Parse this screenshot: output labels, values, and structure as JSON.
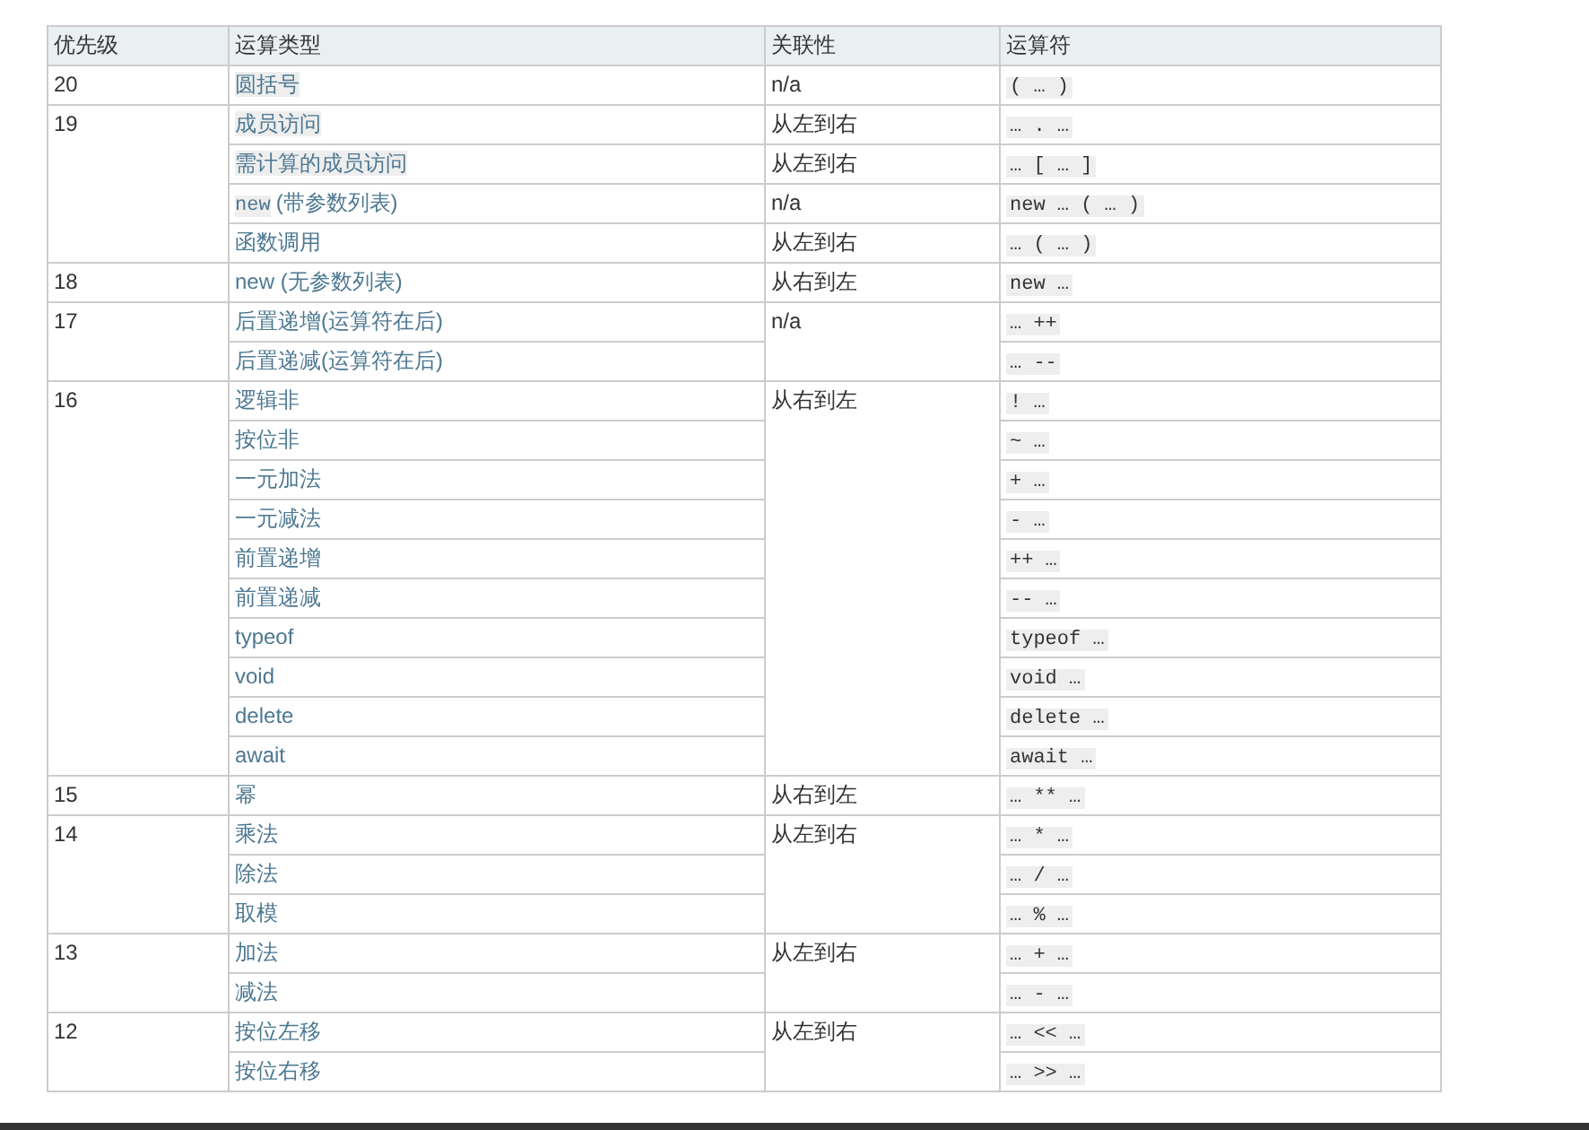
{
  "table": {
    "columns": [
      "优先级",
      "运算类型",
      "关联性",
      "运算符"
    ],
    "groups": [
      {
        "precedence": "20",
        "entries": [
          {
            "type": "圆括号",
            "highlighted": true,
            "associativity": "n/a",
            "operator": "( … )"
          }
        ]
      },
      {
        "precedence": "19",
        "entries": [
          {
            "type": "成员访问",
            "highlighted": true,
            "associativity": "从左到右",
            "operator": "… . …"
          },
          {
            "type": "需计算的成员访问",
            "highlighted": true,
            "associativity": "从左到右",
            "operator": "… [ … ]"
          },
          {
            "code": "new",
            "type": "(带参数列表)",
            "highlighted": false,
            "associativity": "n/a",
            "operator": "new … ( … )"
          },
          {
            "type": "函数调用",
            "highlighted": false,
            "associativity": "从左到右",
            "operator": "… ( … )"
          }
        ]
      },
      {
        "precedence": "18",
        "entries": [
          {
            "type": "new (无参数列表)",
            "highlighted": false,
            "associativity": "从右到左",
            "operator": "new …"
          }
        ]
      },
      {
        "precedence": "17",
        "associativity": "n/a",
        "entries": [
          {
            "type": "后置递增(运算符在后)",
            "highlighted": false,
            "operator": "… ++"
          },
          {
            "type": "后置递减(运算符在后)",
            "highlighted": false,
            "operator": "… --"
          }
        ]
      },
      {
        "precedence": "16",
        "associativity": "从右到左",
        "entries": [
          {
            "type": "逻辑非",
            "highlighted": false,
            "operator": "! …"
          },
          {
            "type": "按位非",
            "highlighted": false,
            "operator": "~ …"
          },
          {
            "type": "一元加法",
            "highlighted": false,
            "operator": "+ …"
          },
          {
            "type": "一元减法",
            "highlighted": false,
            "operator": "- …"
          },
          {
            "type": "前置递增",
            "highlighted": false,
            "operator": "++ …"
          },
          {
            "type": "前置递减",
            "highlighted": false,
            "operator": "-- …"
          },
          {
            "type": "typeof",
            "highlighted": false,
            "operator": "typeof …"
          },
          {
            "type": "void",
            "highlighted": false,
            "operator": "void …"
          },
          {
            "type": "delete",
            "highlighted": false,
            "operator": "delete …"
          },
          {
            "type": "await",
            "highlighted": false,
            "operator": "await …"
          }
        ]
      },
      {
        "precedence": "15",
        "entries": [
          {
            "type": "幂",
            "highlighted": false,
            "associativity": "从右到左",
            "operator": "… ** …"
          }
        ]
      },
      {
        "precedence": "14",
        "associativity": "从左到右",
        "entries": [
          {
            "type": "乘法",
            "highlighted": false,
            "operator": "… * …"
          },
          {
            "type": "除法",
            "highlighted": false,
            "operator": "… / …"
          },
          {
            "type": "取模",
            "highlighted": false,
            "operator": "… % …"
          }
        ]
      },
      {
        "precedence": "13",
        "associativity": "从左到右",
        "entries": [
          {
            "type": "加法",
            "highlighted": false,
            "operator": "… + …"
          },
          {
            "type": "减法",
            "highlighted": false,
            "operator": "… - …"
          }
        ]
      },
      {
        "precedence": "12",
        "associativity": "从左到右",
        "entries": [
          {
            "type": "按位左移",
            "highlighted": false,
            "operator": "… << …"
          },
          {
            "type": "按位右移",
            "highlighted": false,
            "operator": "… >> …"
          }
        ]
      }
    ]
  }
}
